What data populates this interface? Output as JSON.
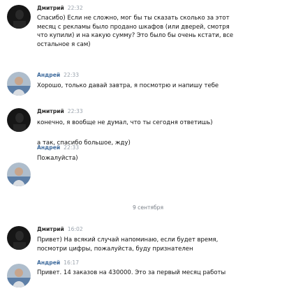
{
  "messages": [
    {
      "author": "Дмитрий",
      "time": "22:32",
      "avatar_type": "dark-avatar",
      "lines": [
        "Спасибо) Если не сложно, мог бы ты сказать сколько за этот",
        "месяц с рекламы было продано шкафов (или дверей, смотря",
        "что купили) и на какую сумму? Это было бы очень кстати, все",
        "остальное я сам)"
      ]
    },
    {
      "author": "Андрей",
      "time": "22:33",
      "avatar_type": "photo-avatar",
      "lines": [
        "Хорошо, только давай завтра, я посмотрю и напишу тебе"
      ]
    },
    {
      "author": "Дмитрий",
      "time": "22:33",
      "avatar_type": "dark-avatar",
      "lines": [
        "конечно, я вообще не думал, что ты сегодня ответишь)"
      ],
      "extra": "а так, спасибо большое, жду)"
    },
    {
      "author": "Андрей",
      "time": "22:33",
      "avatar_type": "photo-avatar",
      "lines": [
        "Пожалуйста)"
      ]
    },
    {
      "author": "Дмитрий",
      "time": "16:02",
      "avatar_type": "dark-avatar",
      "lines": [
        "Привет) На всякий случай напоминаю, если будет время,",
        "посмотри цифры, пожалуйста, буду признателен"
      ]
    },
    {
      "author": "Андрей",
      "time": "16:17",
      "avatar_type": "photo-avatar",
      "lines": [
        "Привет. 14 заказов на 430000. Это за первый месяц работы"
      ]
    }
  ],
  "date_separator": "9 сентября",
  "colors": {
    "author_dmitry": "#2b2b2b",
    "author_andrey": "#3d6a9c",
    "time": "#9aa3ad"
  }
}
